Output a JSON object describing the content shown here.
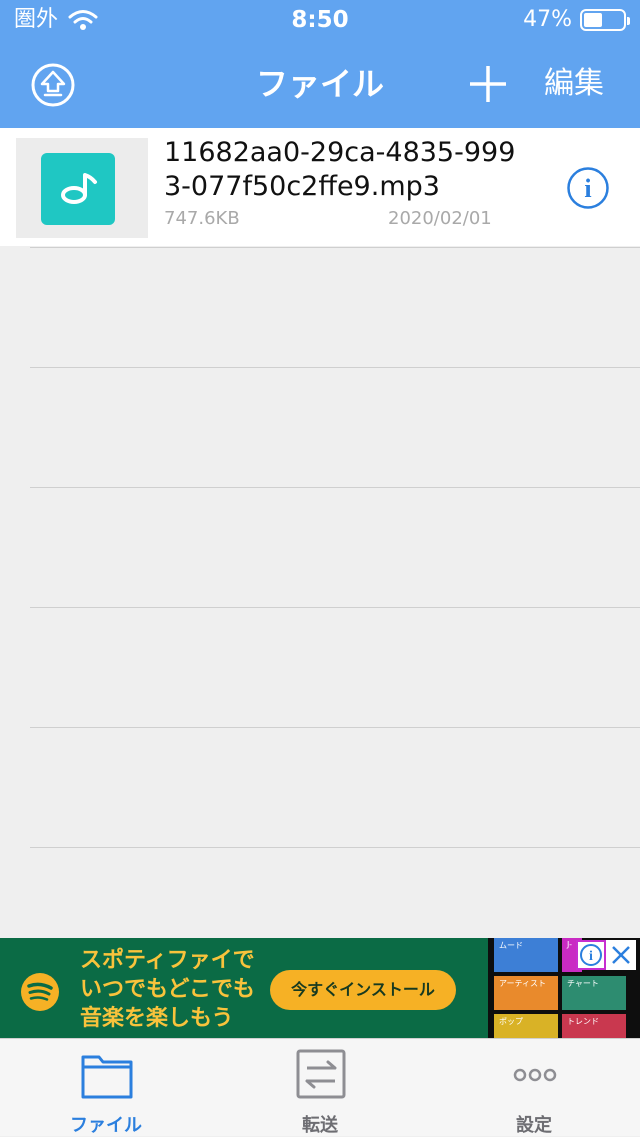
{
  "status_bar": {
    "carrier": "圏外",
    "time": "8:50",
    "battery": "47%",
    "battery_level": 0.47
  },
  "nav": {
    "title": "ファイル",
    "edit_label": "編集"
  },
  "files": [
    {
      "name": "11682aa0-29ca-4835-9993-077f50c2ffe9.mp3",
      "size": "747.6KB",
      "date": "2020/02/01"
    }
  ],
  "ad": {
    "headline_lines": [
      "スポティファイで",
      "いつでもどこでも",
      "音楽を楽しもう"
    ],
    "cta": "今すぐインストール",
    "promo_tiles": [
      "ムード",
      "J-",
      "アーティスト",
      "チャート",
      "ポップ",
      "トレンド"
    ]
  },
  "tabs": [
    {
      "label": "ファイル",
      "active": true
    },
    {
      "label": "転送",
      "active": false
    },
    {
      "label": "設定",
      "active": false
    }
  ],
  "colors": {
    "header": "#61a4f0",
    "accent": "#2b7fde",
    "music_tile": "#1fc7c3",
    "ad_bg": "#0b6b45",
    "ad_text": "#f9c33c",
    "ad_button": "#f6b125"
  }
}
